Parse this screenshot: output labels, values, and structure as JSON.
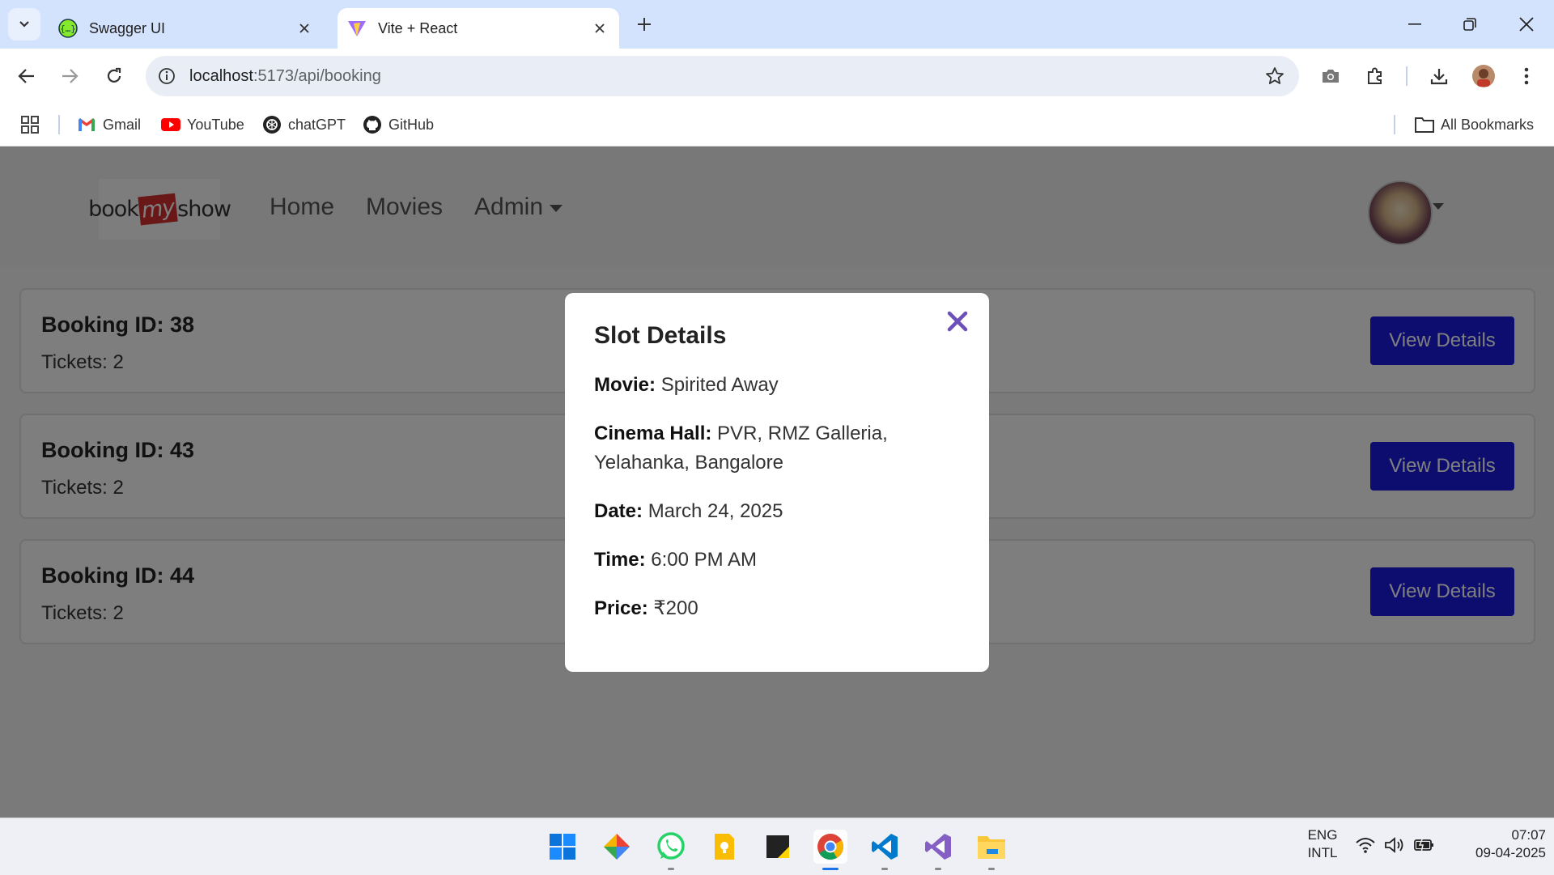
{
  "browser": {
    "tabs": [
      {
        "title": "Swagger UI",
        "active": false
      },
      {
        "title": "Vite + React",
        "active": true
      }
    ],
    "url_host": "localhost",
    "url_path": ":5173/api/booking",
    "bookmarks": [
      "Gmail",
      "YouTube",
      "chatGPT",
      "GitHub"
    ],
    "all_bookmarks": "All Bookmarks"
  },
  "site": {
    "logo": {
      "left": "book",
      "mid": "my",
      "right": "show"
    },
    "nav": {
      "home": "Home",
      "movies": "Movies",
      "admin": "Admin"
    }
  },
  "bookings": [
    {
      "id_label": "Booking ID: 38",
      "tickets": "Tickets: 2",
      "button": "View Details"
    },
    {
      "id_label": "Booking ID: 43",
      "tickets": "Tickets: 2",
      "button": "View Details"
    },
    {
      "id_label": "Booking ID: 44",
      "tickets": "Tickets: 2",
      "button": "View Details"
    }
  ],
  "modal": {
    "title": "Slot Details",
    "movie_label": "Movie:",
    "movie": "Spirited Away",
    "hall_label": "Cinema Hall:",
    "hall": "PVR, RMZ Galleria, Yelahanka, Bangalore",
    "date_label": "Date:",
    "date": "March 24, 2025",
    "time_label": "Time:",
    "time": "6:00 PM AM",
    "price_label": "Price:",
    "price": "₹200",
    "close_color": "#6c4fb8"
  },
  "taskbar": {
    "lang1": "ENG",
    "lang2": "INTL",
    "time": "07:07",
    "date": "09-04-2025"
  },
  "colors": {
    "accent_button": "#1a1adf",
    "tab_strip": "#d3e3fd"
  }
}
